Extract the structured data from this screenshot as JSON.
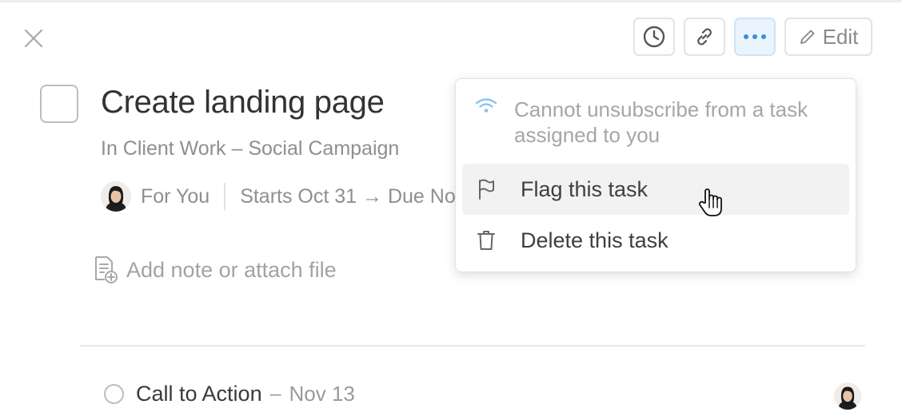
{
  "header": {
    "close_icon": "close-icon",
    "toolbar": {
      "buttons": [
        {
          "name": "clock",
          "icon": "clock-icon"
        },
        {
          "name": "link",
          "icon": "link-icon"
        },
        {
          "name": "more",
          "icon": "more-icon",
          "active": true
        },
        {
          "name": "edit",
          "icon": "pencil-icon",
          "label": "Edit"
        }
      ]
    }
  },
  "task": {
    "title": "Create landing page",
    "project": "In Client Work – Social Campaign",
    "assignee": "For You",
    "dates": "Starts Oct 31 → Due Nov",
    "add_note": "Add note or attach file"
  },
  "subtasks": [
    {
      "title": "Call to Action",
      "separator": "–",
      "due": "Nov 13"
    }
  ],
  "menu": {
    "info": {
      "icon": "subscribe-wifi-icon",
      "text": "Cannot unsubscribe from a task assigned to you"
    },
    "items": [
      {
        "label": "Flag this task",
        "icon": "flag-icon",
        "hover": true
      },
      {
        "label": "Delete this task",
        "icon": "trash-icon"
      }
    ]
  },
  "colors": {
    "accent": "#3b8ee0",
    "active_button_bg": "#eaf4fd",
    "text_primary": "#333333",
    "text_muted": "#8f8f8f"
  }
}
